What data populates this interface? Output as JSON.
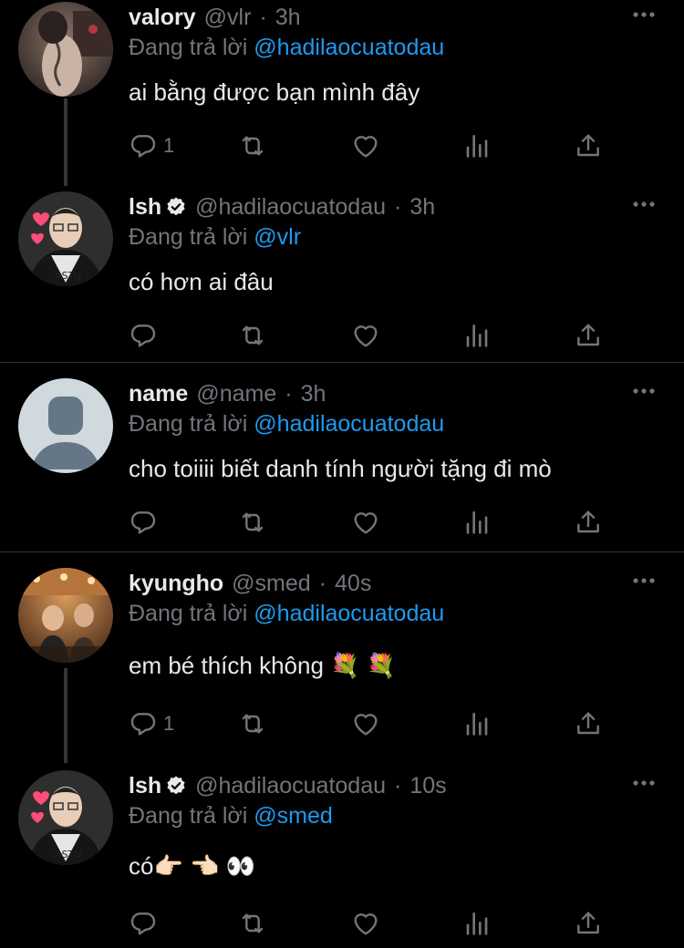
{
  "tweets": [
    {
      "name": "valory",
      "handle": "@vlr",
      "time": "3h",
      "reply_label": "Đang trả lời",
      "reply_mention": "@hadilaocuatodau",
      "text": "ai bằng được bạn mình đây",
      "reply_count": "1"
    },
    {
      "name": "lsh",
      "handle": "@hadilaocuatodau",
      "time": "3h",
      "reply_label": "Đang trả lời",
      "reply_mention": "@vlr",
      "text": "có hơn ai đâu",
      "reply_count": ""
    },
    {
      "name": "name",
      "handle": "@name",
      "time": "3h",
      "reply_label": "Đang trả lời",
      "reply_mention": "@hadilaocuatodau",
      "text": "cho toiiii biết danh tính người tặng đi mò",
      "reply_count": ""
    },
    {
      "name": "kyungho",
      "handle": "@smed",
      "time": "40s",
      "reply_label": "Đang trả lời",
      "reply_mention": "@hadilaocuatodau",
      "text": "em bé thích không 💐 💐",
      "reply_count": "1"
    },
    {
      "name": "lsh",
      "handle": "@hadilaocuatodau",
      "time": "10s",
      "reply_label": "Đang trả lời",
      "reply_mention": "@smed",
      "text": "có👉🏻 👈🏻 👀",
      "reply_count": ""
    }
  ],
  "separator": "·",
  "colors": {
    "background": "#000000",
    "text": "#e7e9ea",
    "muted": "#71767b",
    "accent": "#1d9bf0",
    "divider": "#2f3336"
  },
  "icons": [
    "reply-icon",
    "retweet-icon",
    "like-icon",
    "views-icon",
    "share-icon",
    "more-icon",
    "verified-badge-icon"
  ]
}
